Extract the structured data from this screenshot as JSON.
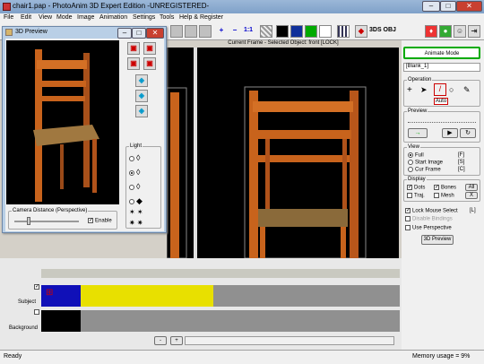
{
  "window": {
    "title": "chair1.pap - PhotoAnim 3D Expert Edition -UNREGISTERED-",
    "minimize": "–",
    "maximize": "□",
    "close": "✕"
  },
  "menu": [
    "File",
    "Edit",
    "View",
    "Mode",
    "Image",
    "Animation",
    "Settings",
    "Tools",
    "Help & Register"
  ],
  "toolbar": {
    "plus": "+",
    "minus": "−",
    "one_to_one": "1:1",
    "export_label": "3DS OBJ"
  },
  "frame_label": "Current Frame - Selected Object: front [LOCK]",
  "preview_window": {
    "title": "3D Preview",
    "light_label": "Light",
    "camera_label": "Camera Distance (Perspective)",
    "enable_label": "Enable",
    "enable_checked": true
  },
  "right_panel": {
    "mode_button": "Animate Mode",
    "object_field": "[Blank_1]",
    "operation_label": "Operation",
    "auto_label": "Auto",
    "preview_label": "Preview",
    "view_label": "View",
    "view_options": [
      {
        "label": "Full",
        "key": "[F]",
        "selected": true
      },
      {
        "label": "Start Image",
        "key": "[S]",
        "selected": false
      },
      {
        "label": "Cur Frame",
        "key": "[C]",
        "selected": false
      }
    ],
    "display_label": "Display",
    "dots": "Dots",
    "bones": "Bones",
    "traj": "Traj.",
    "mesh": "Mesh",
    "all_btn": "All",
    "x_btn": "X",
    "lock_mouse": "Lock Mouse Select",
    "lock_key": "[L]",
    "disable_bindings": "Disable Bindings",
    "use_perspective": "Use Perspective",
    "preview_btn": "3D Preview"
  },
  "timeline": {
    "subject_label": "Subject",
    "background_label": "Background",
    "minus": "-",
    "plus": "+"
  },
  "status": {
    "left": "Ready",
    "right": "Memory usage = 9%"
  },
  "colors": {
    "subject_blue": "#1010b8",
    "subject_yellow": "#e8e000",
    "chair_wood": "#c8631c",
    "accent_green": "#00aa00"
  }
}
